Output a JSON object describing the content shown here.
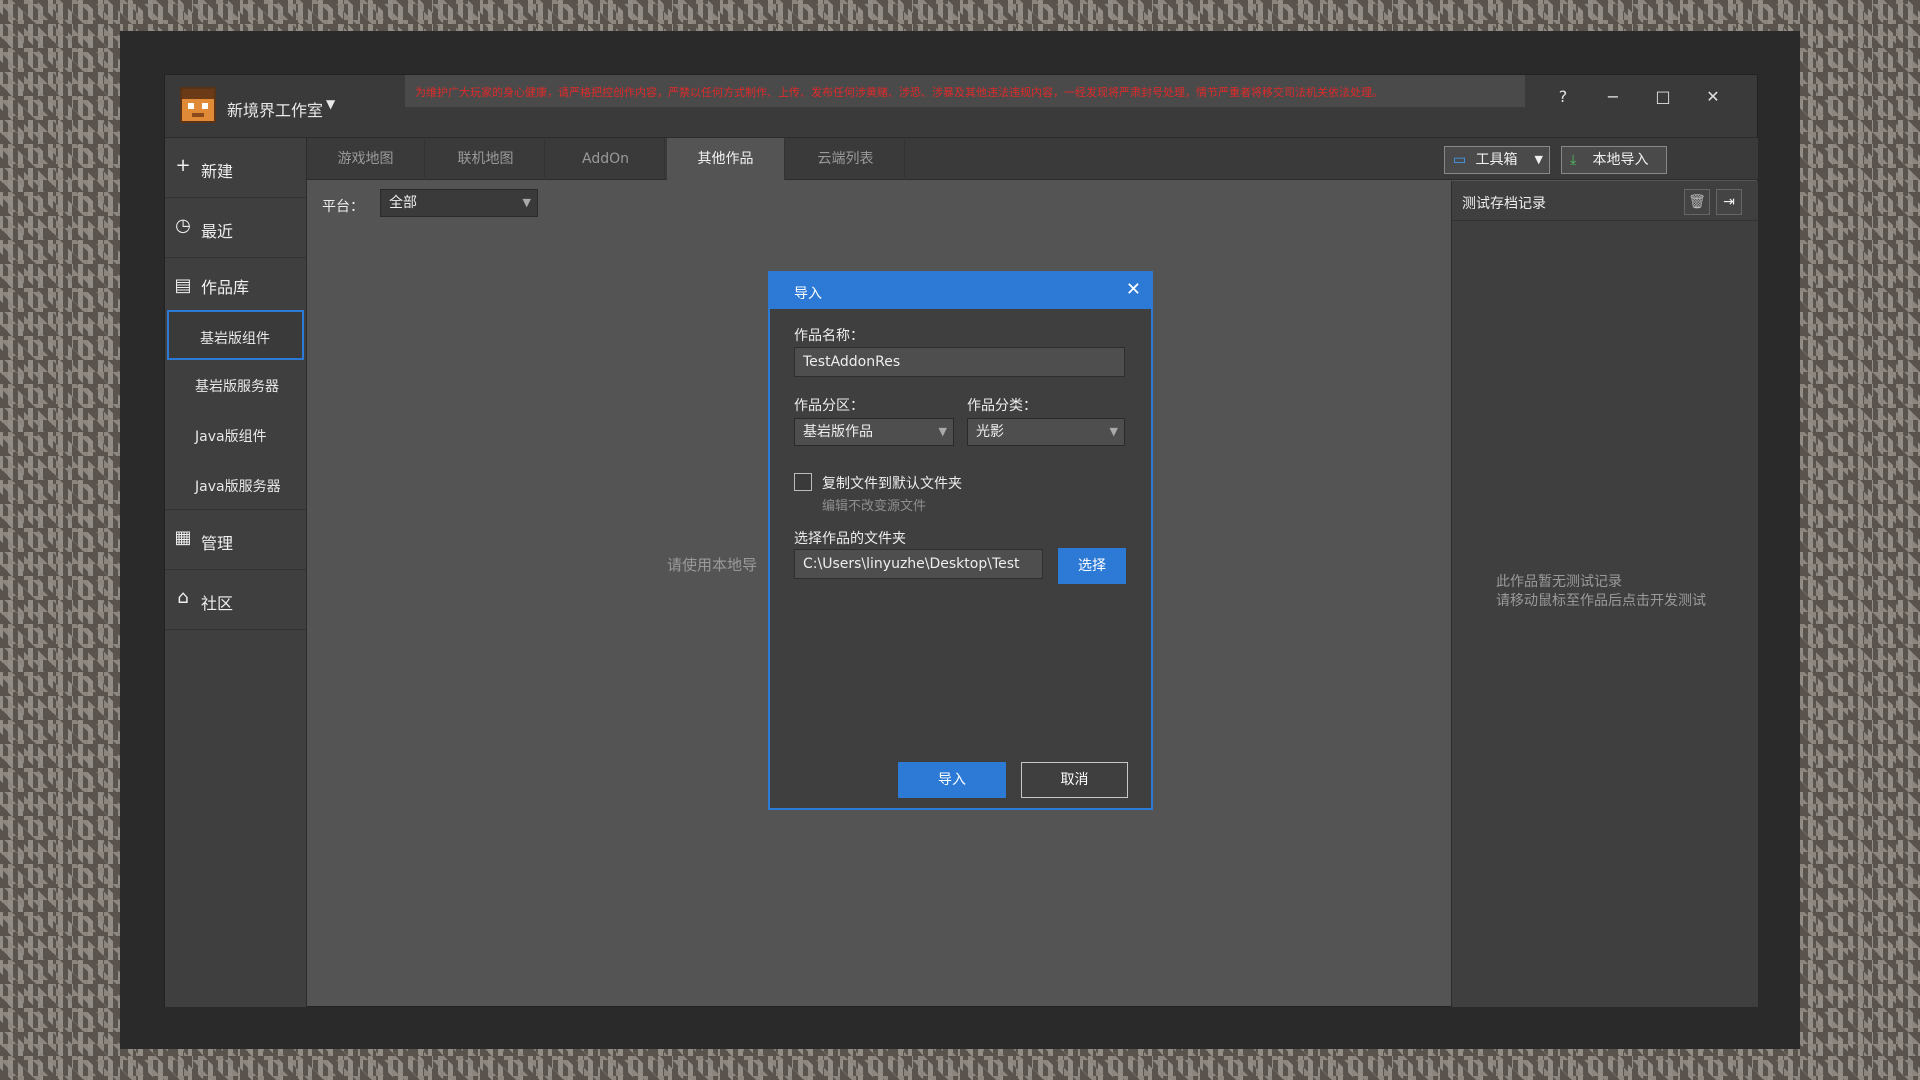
{
  "app": {
    "studio_name": "新境界工作室",
    "notice": "为维护广大玩家的身心健康，请严格把控创作内容，严禁以任何方式制作、上传、发布任何涉黄赌、涉恐、涉暴及其他违法违规内容，一经发现将严肃封号处理，情节严重者将移交司法机关依法处理。",
    "window_controls": {
      "help": "?",
      "minimize": "−",
      "maximize": "□",
      "close": "✕"
    }
  },
  "sidebar": {
    "new": "新建",
    "recent": "最近",
    "library": "作品库",
    "library_items": [
      "基岩版组件",
      "基岩版服务器",
      "Java版组件",
      "Java版服务器"
    ],
    "manage": "管理",
    "community": "社区"
  },
  "tabs": [
    "游戏地图",
    "联机地图",
    "AddOn",
    "其他作品",
    "云端列表"
  ],
  "active_tab": "其他作品",
  "toolbar": {
    "toolbox": "工具箱",
    "local_import": "本地导入"
  },
  "filter": {
    "label": "平台：",
    "value": "全部"
  },
  "main_hint": "请使用本地导",
  "right_panel": {
    "title": "测试存档记录",
    "empty_line1": "此作品暂无测试记录",
    "empty_line2": "请移动鼠标至作品后点击开发测试"
  },
  "dialog": {
    "title": "导入",
    "name_label": "作品名称：",
    "name_value": "TestAddonRes",
    "section_label": "作品分区：",
    "section_value": "基岩版作品",
    "category_label": "作品分类：",
    "category_value": "光影",
    "copy_checkbox_label": "复制文件到默认文件夹",
    "copy_checkbox_hint": "编辑不改变源文件",
    "copy_checked": false,
    "folder_label": "选择作品的文件夹",
    "folder_value": "C:\\Users\\linyuzhe\\Desktop\\Test",
    "choose_button": "选择",
    "import_button": "导入",
    "cancel_button": "取消"
  },
  "colors": {
    "accent": "#2d7ad6",
    "notice": "#e02a2a"
  }
}
